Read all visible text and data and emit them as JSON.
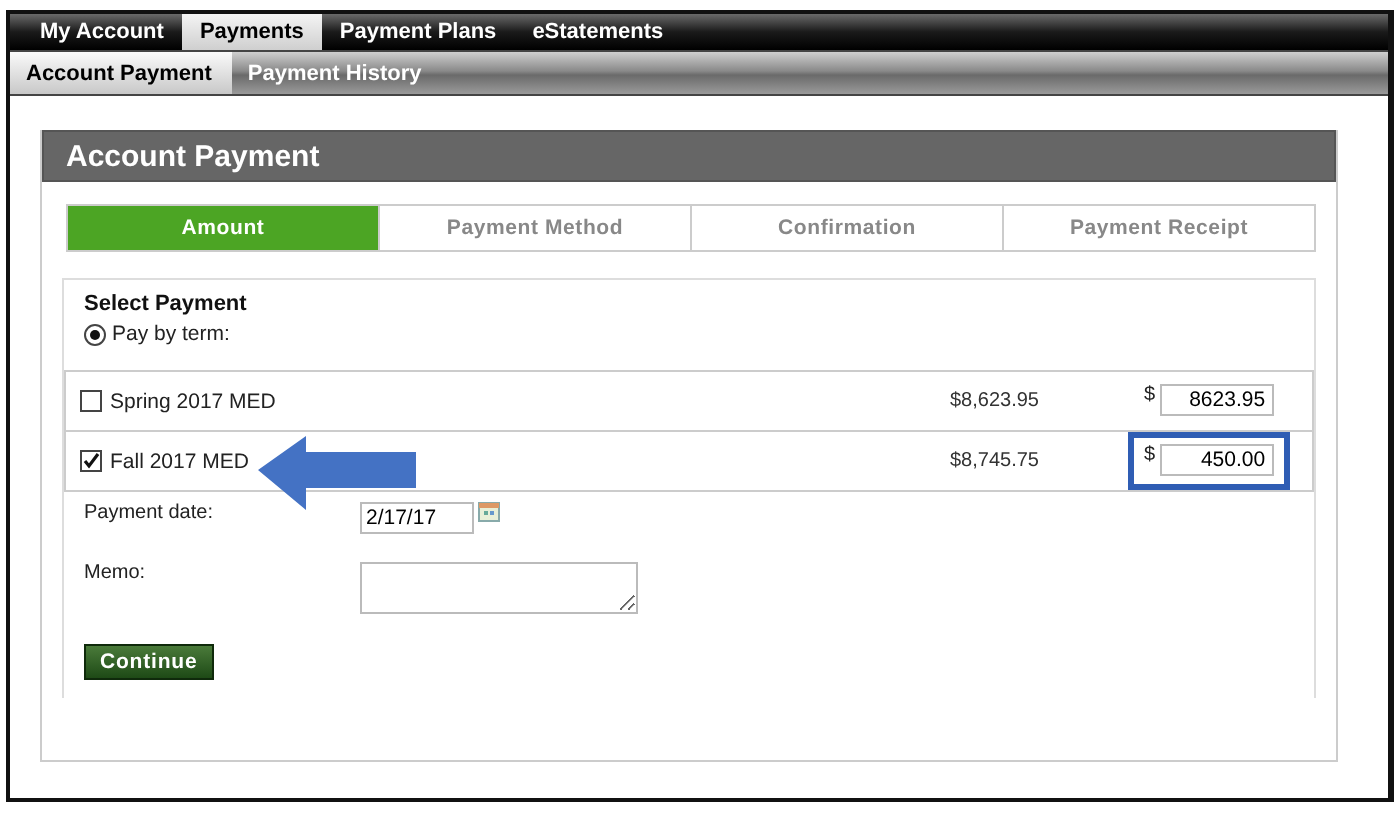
{
  "main_nav": [
    {
      "label": "My Account",
      "selected": false
    },
    {
      "label": "Payments",
      "selected": true
    },
    {
      "label": "Payment Plans",
      "selected": false
    },
    {
      "label": "eStatements",
      "selected": false
    }
  ],
  "sub_nav": [
    {
      "label": "Account Payment",
      "selected": true
    },
    {
      "label": "Payment History",
      "selected": false
    }
  ],
  "panel": {
    "title": "Account Payment"
  },
  "steps": [
    {
      "label": "Amount",
      "selected": true
    },
    {
      "label": "Payment Method",
      "selected": false
    },
    {
      "label": "Confirmation",
      "selected": false
    },
    {
      "label": "Payment Receipt",
      "selected": false
    }
  ],
  "form": {
    "heading": "Select Payment",
    "option": {
      "label": "Pay by term:",
      "selected": true
    },
    "terms": [
      {
        "name": "Spring 2017 MED",
        "checked": false,
        "balance": "$8,623.95",
        "currency": "$",
        "amount": "8623.95",
        "highlighted": false
      },
      {
        "name": "Fall 2017 MED",
        "checked": true,
        "balance": "$8,745.75",
        "currency": "$",
        "amount": "450.00",
        "highlighted": true
      }
    ],
    "payment_date": {
      "label": "Payment date:",
      "value": "2/17/17"
    },
    "memo": {
      "label": "Memo:"
    },
    "continue_button": "Continue"
  }
}
